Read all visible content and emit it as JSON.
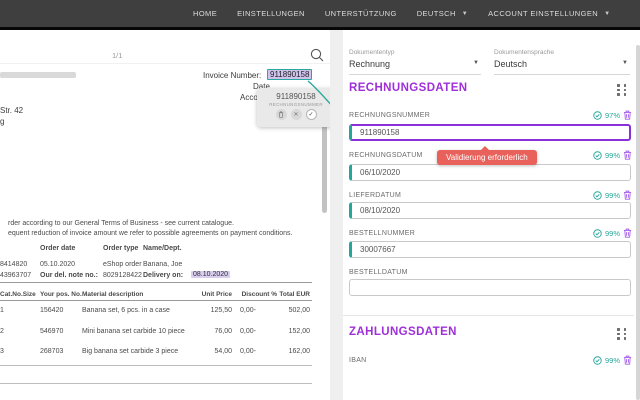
{
  "navbar": {
    "items": [
      {
        "label": "HOME"
      },
      {
        "label": "EINSTELLUNGEN"
      },
      {
        "label": "UNTERSTÜTZUNG"
      },
      {
        "label": "DEUTSCH"
      },
      {
        "label": "ACCOUNT EINSTELLUNGEN"
      }
    ]
  },
  "viewer": {
    "page_indicator": "1/1"
  },
  "invoice": {
    "number_label": "Invoice Number:",
    "number_value": "911890158",
    "date_label": "Date",
    "account_label": "Acco",
    "address_fragment_1": "Str. 42",
    "address_fragment_2": "g",
    "terms_line_1": "rder according to our General Terms of Business - see current catalogue.",
    "terms_line_2": "equent reduction of invoice amount we refer to possible agreements on payment conditions.",
    "order_block": {
      "h_date": "Order date",
      "h_type": "Order type",
      "h_name": "Name/Dept.",
      "r1_num": "8414820",
      "r1_date": "05.10.2020",
      "r1_type": "eShop order",
      "r1_name": "Banana, Joe",
      "r2_num": "43963707",
      "r2_label": "Our del. note no.:",
      "r2_note": "8029128422",
      "r2_delivery_label": "Delivery on:",
      "r2_delivery_date": "08.10.2020"
    },
    "items_table": {
      "headers": [
        "Cat.No.Size",
        "Your pos. No.",
        "Material description",
        "Unit Price",
        "Discount %",
        "Total EUR"
      ],
      "rows": [
        [
          "1",
          "156420",
          "Banana set, 6 pcs. in a case",
          "125,50",
          "0,00-",
          "502,00"
        ],
        [
          "2",
          "546970",
          "Mini banana set carbide 10 piece",
          "76,00",
          "0,00-",
          "152,00"
        ],
        [
          "3",
          "268703",
          "Big banana set carbide 3 piece",
          "54,00",
          "0,00-",
          "162,00"
        ]
      ]
    }
  },
  "popup": {
    "value": "911890158",
    "field_label": "RECHNUNGSNUMMER"
  },
  "tooltip": {
    "text": "Validierung erforderlich"
  },
  "panel": {
    "selects": [
      {
        "label": "Dokumententyp",
        "value": "Rechnung"
      },
      {
        "label": "Dokumentensprache",
        "value": "Deutsch"
      }
    ],
    "sections": [
      {
        "title": "RECHNUNGSDATEN",
        "fields": [
          {
            "label": "RECHNUNGSNUMMER",
            "value": "911890158",
            "confidence": "97%"
          },
          {
            "label": "RECHNUNGSDATUM",
            "value": "06/10/2020",
            "confidence": "99%"
          },
          {
            "label": "LIEFERDATUM",
            "value": "08/10/2020",
            "confidence": "99%"
          },
          {
            "label": "BESTELLNUMMER",
            "value": "30007667",
            "confidence": "99%"
          },
          {
            "label": "BESTELLDATUM",
            "value": "",
            "confidence": ""
          }
        ]
      },
      {
        "title": "ZAHLUNGSDATEN",
        "fields": [
          {
            "label": "IBAN",
            "confidence": "99%"
          }
        ]
      }
    ]
  },
  "colors": {
    "accent_teal": "#26a69a",
    "accent_purple": "#9e2fd9",
    "trash_purple": "#a55ce8",
    "error_red": "#e8615a",
    "highlight_lavender": "#cfc3ee",
    "navbar_bg": "#3f3f3f"
  }
}
